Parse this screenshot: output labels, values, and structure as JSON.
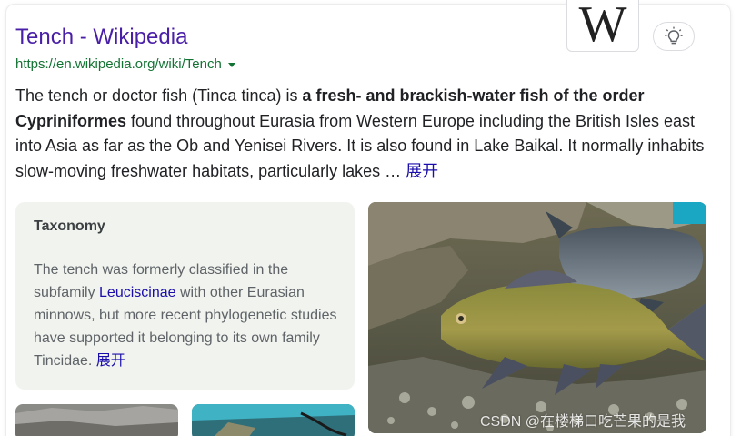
{
  "result": {
    "title": "Tench - Wikipedia",
    "url": "https://en.wikipedia.org/wiki/Tench",
    "logo_letter": "W",
    "snippet": {
      "part1": "The tench or doctor fish (Tinca tinca) is ",
      "bold1": "a fresh- and brackish-water fish of the order Cypriniformes",
      "part2": " found throughout Eurasia from Western Europe including the British Isles east into Asia as far as the Ob and Yenisei Rivers. It is also found in Lake Baikal. It normally inhabits slow-moving freshwater habitats, particularly lakes … ",
      "expand_label": "展开"
    }
  },
  "taxonomy": {
    "title": "Taxonomy",
    "body_before": "The tench was formerly classified in the subfamily ",
    "link": "Leuciscinae",
    "body_after": " with other Eurasian minnows, but more recent phylogenetic studies have supported it belonging to its own family Tincidae. ",
    "expand_label": "展开"
  },
  "watermark": "CSDN @在楼梯口吃芒果的是我",
  "colors": {
    "title_link": "#4a1fa8",
    "url": "#137333",
    "link": "#1a0dab",
    "card_bg": "#f1f4ee"
  },
  "icons": [
    "wikipedia-logo-icon",
    "lightbulb-icon",
    "dropdown-caret-icon"
  ]
}
